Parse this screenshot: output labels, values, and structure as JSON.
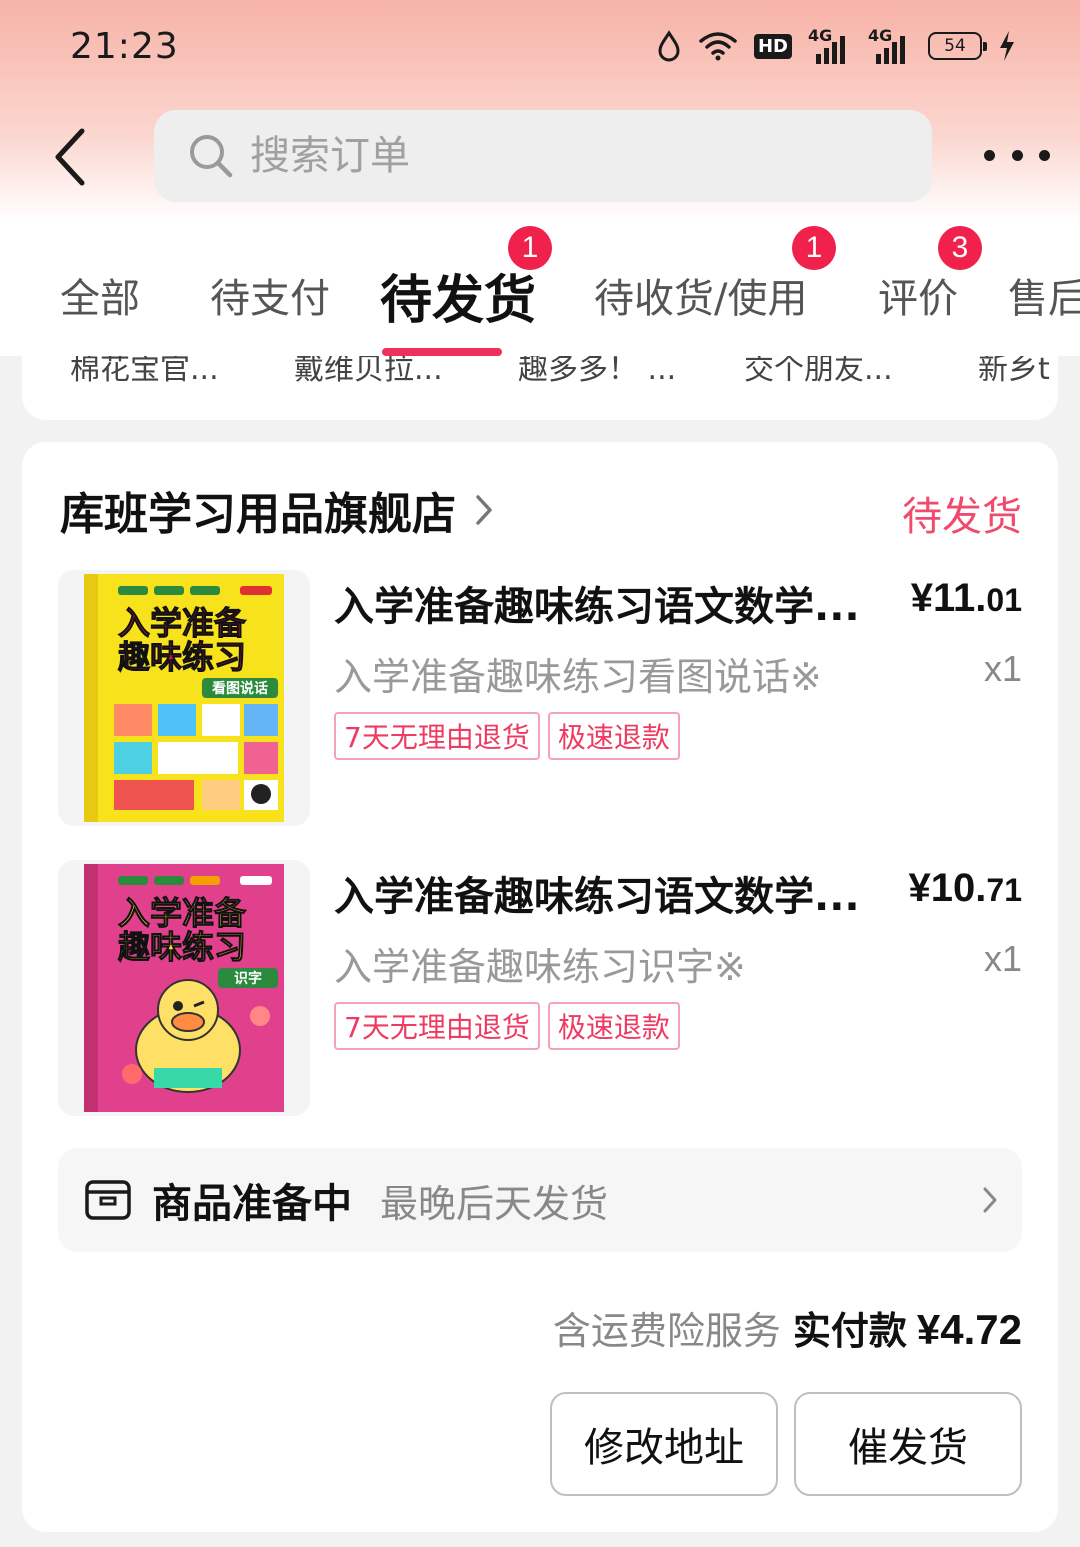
{
  "status_bar": {
    "time": "21:23",
    "hd": "HD",
    "net1": "4G",
    "net2": "4G",
    "battery": "54"
  },
  "header": {
    "search_placeholder": "搜索订单"
  },
  "tabs": [
    {
      "label": "全部"
    },
    {
      "label": "待支付"
    },
    {
      "label": "待发货",
      "badge": "1"
    },
    {
      "label": "待收货/使用",
      "badge": "1"
    },
    {
      "label": "评价",
      "badge": "3"
    },
    {
      "label": "售后"
    }
  ],
  "prev_shops": [
    "棉花宝官...",
    "戴维贝拉...",
    "趣多多！ ...",
    "交个朋友...",
    "新乡t"
  ],
  "order": {
    "shop_name": "库班学习用品旗舰店",
    "status": "待发货",
    "items": [
      {
        "title": "入学准备趣味练习语文数学...",
        "price_int": "¥11.",
        "price_dec": "01",
        "spec": "入学准备趣味练习看图说话※",
        "qty": "x1",
        "tags": [
          "7天无理由退货",
          "极速退款"
        ],
        "cover": {
          "title1": "入学准备",
          "title2": "趣味练习",
          "sub": "看图说话"
        }
      },
      {
        "title": "入学准备趣味练习语文数学...",
        "price_int": "¥10.",
        "price_dec": "71",
        "spec": "入学准备趣味练习识字※",
        "qty": "x1",
        "tags": [
          "7天无理由退货",
          "极速退款"
        ],
        "cover": {
          "title1": "入学准备",
          "title2": "趣味练习",
          "sub": "识字"
        }
      }
    ],
    "shipping": {
      "label": "商品准备中",
      "desc": "最晚后天发货"
    },
    "total": {
      "insurance": "含运费险服务",
      "paid_label": "实付款",
      "paid_value": "¥4.72"
    },
    "buttons": {
      "modify_address": "修改地址",
      "urge_shipping": "催发货"
    }
  },
  "colors": {
    "accent": "#f04a6c",
    "badge": "#f0214a",
    "underline": "#f0305a"
  }
}
